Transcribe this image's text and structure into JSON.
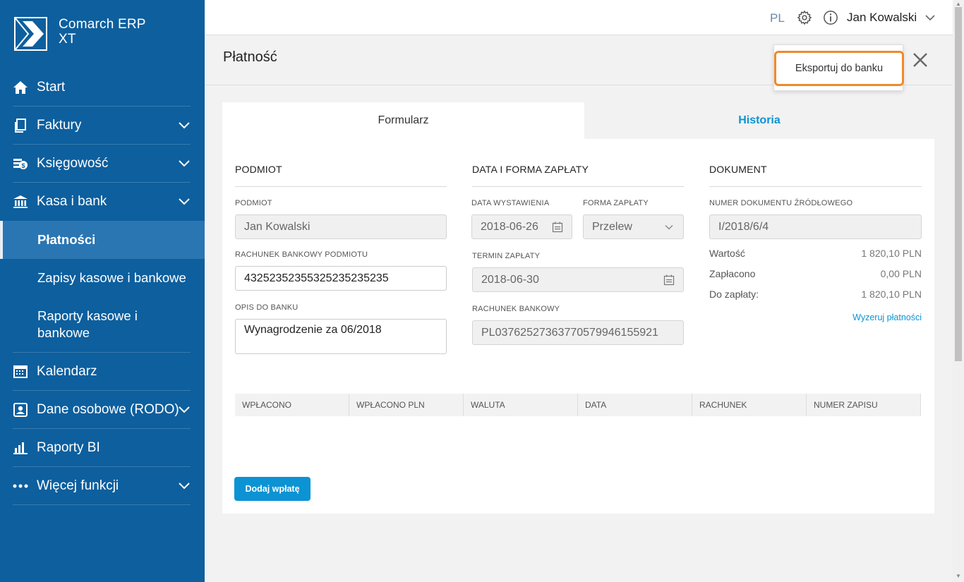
{
  "app": {
    "name_line1": "Comarch ERP",
    "name_line2": "XT"
  },
  "sidebar": {
    "items": [
      {
        "label": "Start",
        "icon": "home-icon"
      },
      {
        "label": "Faktury",
        "icon": "document-icon"
      },
      {
        "label": "Księgowość",
        "icon": "accounting-icon"
      },
      {
        "label": "Kasa i bank",
        "icon": "bank-icon"
      },
      {
        "label": "Kalendarz",
        "icon": "calendar-icon"
      },
      {
        "label": "Dane osobowe (RODO)",
        "icon": "person-icon"
      },
      {
        "label": "Raporty BI",
        "icon": "bar-chart-icon"
      },
      {
        "label": "Więcej funkcji",
        "icon": "more-icon"
      }
    ],
    "subitems": [
      {
        "label": "Płatności",
        "active": true
      },
      {
        "label": "Zapisy kasowe i bankowe"
      },
      {
        "label_line1": "Raporty kasowe i",
        "label_line2": "bankowe"
      }
    ]
  },
  "topbar": {
    "lang": "PL",
    "user": "Jan Kowalski"
  },
  "page": {
    "title": "Płatność",
    "menu": {
      "export": "Eksportuj do banku"
    }
  },
  "tabs": {
    "form": "Formularz",
    "history": "Historia"
  },
  "podmiot": {
    "heading": "PODMIOT",
    "podmiot_label": "PODMIOT",
    "podmiot_value": "Jan Kowalski",
    "account_label": "RACHUNEK BANKOWY PODMIOTU",
    "account_value": "43252352355325235235235",
    "desc_label": "OPIS DO BANKU",
    "desc_value": "Wynagrodzenie za 06/2018"
  },
  "payment": {
    "heading": "DATA I FORMA ZAPŁATY",
    "issue_label": "DATA WYSTAWIENIA",
    "issue_value": "2018-06-26",
    "form_label": "FORMA ZAPŁATY",
    "form_value": "Przelew",
    "due_label": "TERMIN ZAPŁATY",
    "due_value": "2018-06-30",
    "bank_label": "RACHUNEK BANKOWY",
    "bank_value": "PL03762527363770579946155921"
  },
  "document": {
    "heading": "DOKUMENT",
    "src_label": "NUMER DOKUMENTU ŹRÓDŁOWEGO",
    "src_value": "I/2018/6/4",
    "value_label": "Wartość",
    "value_amount": "1 820,10 PLN",
    "paid_label": "Zapłacono",
    "paid_amount": "0,00 PLN",
    "due_label": "Do zapłaty:",
    "due_amount": "1 820,10 PLN",
    "reset_link": "Wyzeruj płatności"
  },
  "table": {
    "columns": [
      "WPŁACONO",
      "WPŁACONO PLN",
      "WALUTA",
      "DATA",
      "RACHUNEK",
      "NUMER ZAPISU"
    ]
  },
  "actions": {
    "add_payment": "Dodaj wpłatę"
  }
}
